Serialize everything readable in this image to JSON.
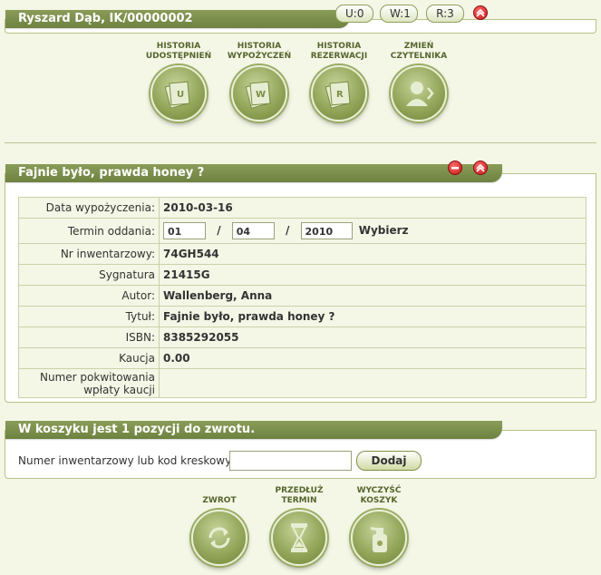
{
  "reader": {
    "name": "Ryszard Dąb, IK/00000002",
    "counts": {
      "u": "U:0",
      "w": "W:1",
      "r": "R:3"
    },
    "actions": [
      {
        "label": "HISTORIA UDOSTĘPNIEŃ",
        "icon": "history-shares-icon"
      },
      {
        "label": "HISTORIA WYPOŻYCZEŃ",
        "icon": "history-loans-icon"
      },
      {
        "label": "HISTORIA REZERWACJI",
        "icon": "history-reservations-icon"
      },
      {
        "label": "ZMIEŃ CZYTELNIKA",
        "icon": "change-reader-icon"
      }
    ]
  },
  "loan": {
    "title": "Fajnie było, prawda honey ?",
    "labels": {
      "date": "Data wypożyczenia:",
      "due": "Termin oddania:",
      "inventory": "Nr inwentarzowy:",
      "signature": "Sygnatura",
      "author": "Autor:",
      "title": "Tytuł:",
      "isbn": "ISBN:",
      "deposit": "Kaucja",
      "receipt": "Numer pokwitowania wpłaty kaucji"
    },
    "values": {
      "date": "2010-03-16",
      "due_day": "01",
      "due_month": "04",
      "due_year": "2010",
      "choose": "Wybierz",
      "inventory": "74GH544",
      "signature": "21415G",
      "author": "Wallenberg, Anna",
      "title": "Fajnie było, prawda honey ?",
      "isbn": "8385292055",
      "deposit": "0.00",
      "receipt": ""
    },
    "sep": "/"
  },
  "cart": {
    "title": "W koszyku jest 1 pozycji do zwrotu.",
    "field_label": "Numer inwentarzowy lub kod kreskowy",
    "field_value": "",
    "add_label": "Dodaj",
    "actions": [
      {
        "label": "ZWROT",
        "icon": "return-icon"
      },
      {
        "label": "PRZEDŁUŻ TERMIN",
        "icon": "extend-hourglass-icon"
      },
      {
        "label": "WYCZYŚĆ KOSZYK",
        "icon": "clear-cart-spray-icon"
      }
    ]
  },
  "colors": {
    "accent": "#7d9050",
    "panel_bg": "#f4f6e6",
    "danger": "#c11818"
  }
}
